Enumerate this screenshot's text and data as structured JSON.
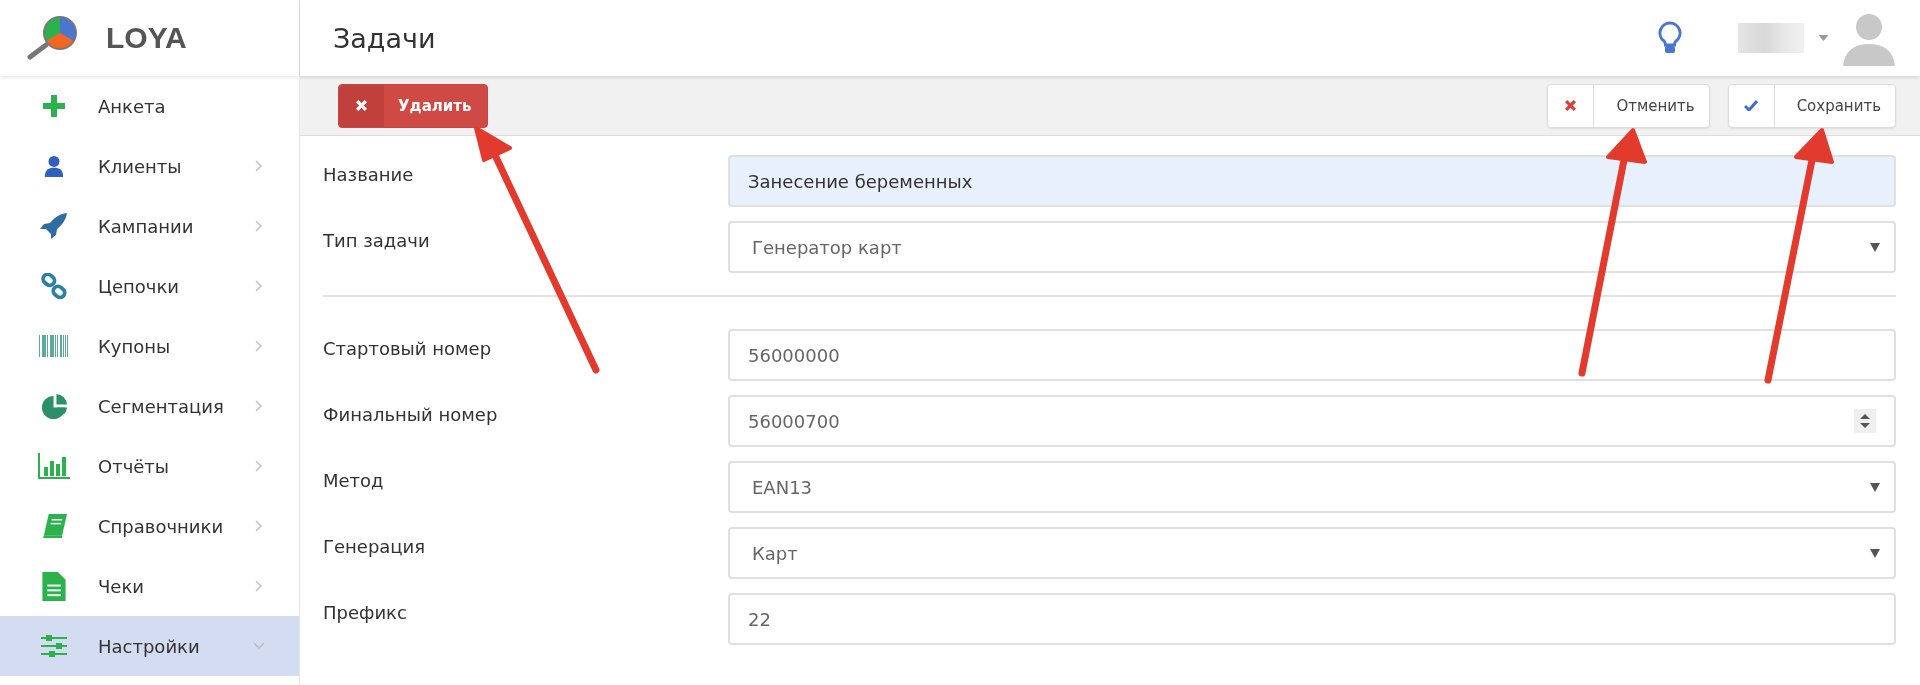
{
  "brand": {
    "name": "LOYA"
  },
  "sidebar": {
    "items": [
      {
        "label": "Анкета",
        "has_submenu": false,
        "expanded": false,
        "selected": false
      },
      {
        "label": "Клиенты",
        "has_submenu": true,
        "expanded": false,
        "selected": false
      },
      {
        "label": "Кампании",
        "has_submenu": true,
        "expanded": false,
        "selected": false
      },
      {
        "label": "Цепочки",
        "has_submenu": true,
        "expanded": false,
        "selected": false
      },
      {
        "label": "Купоны",
        "has_submenu": true,
        "expanded": false,
        "selected": false
      },
      {
        "label": "Сегментация",
        "has_submenu": true,
        "expanded": false,
        "selected": false
      },
      {
        "label": "Отчёты",
        "has_submenu": true,
        "expanded": false,
        "selected": false
      },
      {
        "label": "Справочники",
        "has_submenu": true,
        "expanded": false,
        "selected": false
      },
      {
        "label": "Чеки",
        "has_submenu": true,
        "expanded": false,
        "selected": false
      },
      {
        "label": "Настройки",
        "has_submenu": true,
        "expanded": true,
        "selected": true
      }
    ]
  },
  "header": {
    "title": "Задачи"
  },
  "toolbar": {
    "buttons": [
      {
        "kind": "delete",
        "label": "Удалить"
      },
      {
        "kind": "cancel",
        "label": "Отменить"
      },
      {
        "kind": "save",
        "label": "Сохранить"
      }
    ]
  },
  "form": {
    "sections": [
      [
        {
          "label": "Название",
          "kind": "text",
          "value": "Занесение беременных",
          "autofilled": true
        },
        {
          "label": "Тип задачи",
          "kind": "select",
          "value": "Генератор карт",
          "autofilled": false
        }
      ],
      [
        {
          "label": "Стартовый номер",
          "kind": "text",
          "value": "56000000",
          "autofilled": false
        },
        {
          "label": "Финальный номер",
          "kind": "number",
          "value": "56000700",
          "autofilled": false
        },
        {
          "label": "Метод",
          "kind": "select",
          "value": "EAN13",
          "autofilled": false
        },
        {
          "label": "Генерация",
          "kind": "select",
          "value": "Карт",
          "autofilled": false
        },
        {
          "label": "Префикс",
          "kind": "text",
          "value": "22",
          "autofilled": false
        }
      ]
    ]
  }
}
